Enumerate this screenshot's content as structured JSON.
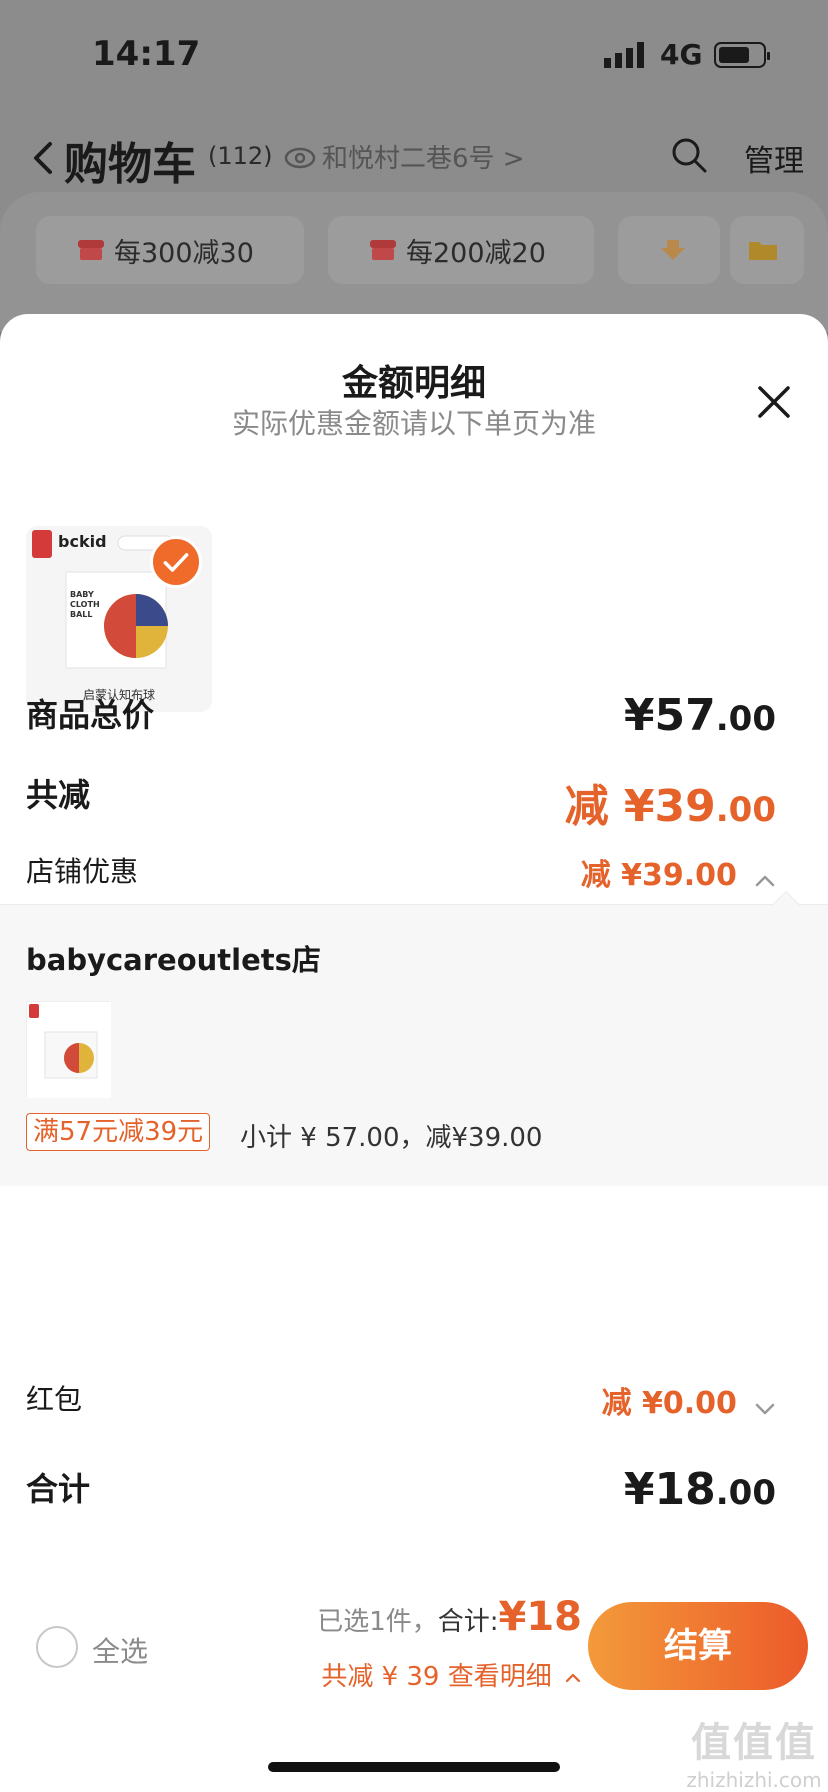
{
  "status_bar": {
    "time": "14:17",
    "network": "4G"
  },
  "nav": {
    "title": "购物车",
    "count": "(112)",
    "location": "和悦村二巷6号 >",
    "manage": "管理"
  },
  "coupons": [
    {
      "label": "每300减30"
    },
    {
      "label": "每200减20"
    }
  ],
  "sheet": {
    "title": "金额明细",
    "subtitle": "实际优惠金额请以下单页为准",
    "product": {
      "brand": "bckid",
      "caption": "启蒙认知布球",
      "box_text": "BABY CLOTH BALL"
    },
    "rows": {
      "total_label": "商品总价",
      "total_value": "¥57",
      "total_cents": ".00",
      "discount_label": "共减",
      "discount_value": "减 ¥39",
      "discount_cents": ".00",
      "shop_promo_label": "店铺优惠",
      "shop_promo_value": "减 ¥39.00",
      "redpacket_label": "红包",
      "redpacket_value": "减 ¥0.00",
      "sum_label": "合计",
      "sum_value": "¥18",
      "sum_cents": ".00"
    },
    "shop": {
      "name": "babycareoutlets店",
      "promo_tag": "满57元减39元",
      "promo_detail": "小计 ¥ 57.00，减¥39.00"
    }
  },
  "bottom_bar": {
    "select_all": "全选",
    "selected_text": "已选1件，",
    "sum_label": "合计:",
    "sum_amount": "¥18",
    "saving_text": "共减 ¥ 39  查看明细",
    "checkout": "结算"
  },
  "watermark": {
    "big": "值值值",
    "small": "zhizhizhi.com"
  },
  "colors": {
    "accent": "#e5622a",
    "checkout_start": "#f39a3a",
    "checkout_end": "#ec5a2a"
  }
}
